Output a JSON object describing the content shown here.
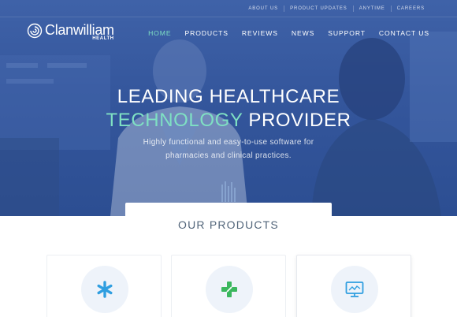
{
  "topbar": {
    "links": [
      "ABOUT US",
      "PRODUCT UPDATES",
      "ANYTIME",
      "CAREERS"
    ]
  },
  "logo": {
    "name": "Clanwilliam",
    "sub": "HEALTH"
  },
  "nav": {
    "items": [
      "HOME",
      "PRODUCTS",
      "REVIEWS",
      "NEWS",
      "SUPPORT",
      "CONTACT US"
    ],
    "active": "HOME"
  },
  "hero": {
    "title_line1": "LEADING HEALTHCARE",
    "title_accent": "TECHNOLOGY",
    "title_rest": "PROVIDER",
    "subtitle_line1": "Highly functional and easy-to-use software for",
    "subtitle_line2": "pharmacies and clinical practices."
  },
  "products": {
    "heading": "OUR PRODUCTS",
    "cards": [
      {
        "icon": "asterisk-icon",
        "color": "#2f9ee0"
      },
      {
        "icon": "pharmacy-cross-icon",
        "color": "#3bb75e"
      },
      {
        "icon": "monitor-icon",
        "color": "#2f9ee0"
      }
    ]
  },
  "colors": {
    "hero_blue": "#3a5da3",
    "accent_teal": "#7fe0c3",
    "heading_gray": "#52657a"
  }
}
